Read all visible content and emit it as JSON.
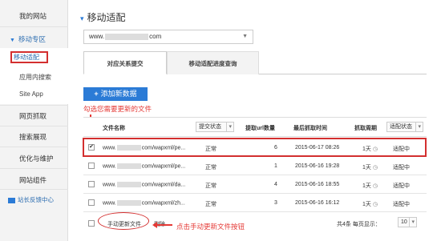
{
  "sidebar": {
    "my_site": "我的网站",
    "mobile_zone": "移动专区",
    "mobile_adapt": "移动适配",
    "in_app_search": "应用内搜索",
    "site_app": "Site App",
    "crawl": "网页抓取",
    "search_display": "搜索展现",
    "optimize": "优化与维护",
    "components": "网站组件",
    "feedback": "站长反馈中心"
  },
  "page": {
    "title": "移动适配",
    "site_prefix": "www.",
    "site_suffix": "com"
  },
  "tabs": [
    {
      "label": "对应关系提交"
    },
    {
      "label": "移动适配进度查询"
    }
  ],
  "toolbar": {
    "add_label": "添加新数据"
  },
  "annotations": {
    "check_files": "勾选您需要更新的文件",
    "click_update": "点击手动更新文件按钮"
  },
  "table": {
    "headers": {
      "file_name": "文件名称",
      "submit_status": "提交状态",
      "url_count": "提取url数量",
      "last_crawl": "最后抓取时间",
      "crawl_cycle": "抓取周期",
      "adapt_status": "适配状态"
    },
    "rows": [
      {
        "checked": "✔",
        "prefix": "www.",
        "path": "com/wapxml/pe...",
        "status": "正常",
        "count": "6",
        "time": "2015-06-17 08:26",
        "cycle": "1天",
        "adapt": "适配中"
      },
      {
        "checked": "",
        "prefix": "www.",
        "path": "com/wapxml/pe...",
        "status": "正常",
        "count": "1",
        "time": "2015-06-16 19:28",
        "cycle": "1天",
        "adapt": "适配中"
      },
      {
        "checked": "",
        "prefix": "www.",
        "path": "com/wapxml/da...",
        "status": "正常",
        "count": "4",
        "time": "2015-06-16 18:55",
        "cycle": "1天",
        "adapt": "适配中"
      },
      {
        "checked": "",
        "prefix": "www.",
        "path": "com/wapxml/zh...",
        "status": "正常",
        "count": "3",
        "time": "2015-06-16 16:12",
        "cycle": "1天",
        "adapt": "适配中"
      }
    ]
  },
  "footer": {
    "manual_update": "手动更新文件",
    "delete": "删除",
    "summary": "共4条 每页显示：",
    "page_size": "10"
  },
  "colors": {
    "accent": "#2b7bd6",
    "annotation": "#d32f2f"
  }
}
